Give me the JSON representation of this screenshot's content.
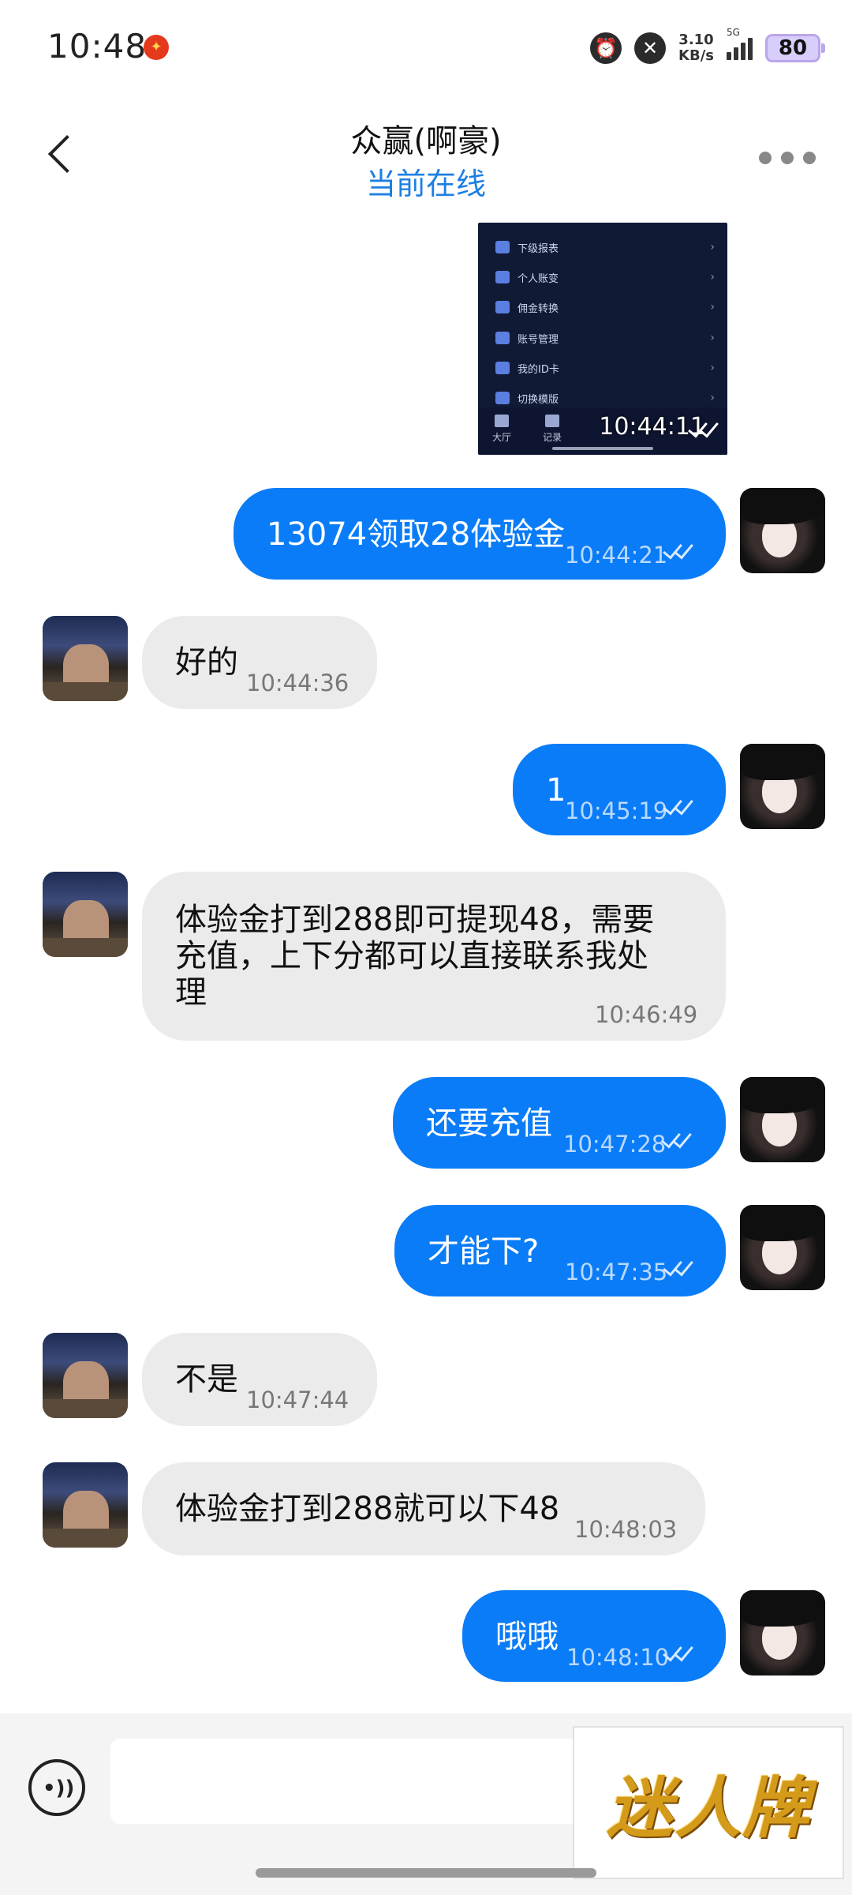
{
  "status_bar": {
    "time": "10:48",
    "net_speed_value": "3.10",
    "net_speed_unit": "KB/s",
    "network_label": "5G",
    "battery": "80"
  },
  "header": {
    "title": "众赢(啊豪)",
    "status": "当前在线"
  },
  "image_message": {
    "menu_items": [
      "下级报表",
      "个人账变",
      "佣金转换",
      "账号管理",
      "我的ID卡",
      "切换模版"
    ],
    "nav_items": [
      "大厅",
      "记录"
    ],
    "time": "10:44:11"
  },
  "messages": [
    {
      "dir": "out",
      "text": "13074领取28体验金",
      "time": "10:44:21"
    },
    {
      "dir": "in",
      "text": "好的",
      "time": "10:44:36"
    },
    {
      "dir": "out",
      "text": "1",
      "time": "10:45:19"
    },
    {
      "dir": "in",
      "lines": [
        "体验金打到288即可提现48，需要",
        "充值，上下分都可以直接联系我处",
        "理"
      ],
      "time": "10:46:49"
    },
    {
      "dir": "out",
      "text": "还要充值",
      "time": "10:47:28"
    },
    {
      "dir": "out",
      "text": "才能下?",
      "time": "10:47:35"
    },
    {
      "dir": "in",
      "text": "不是",
      "time": "10:47:44"
    },
    {
      "dir": "in",
      "text": "体验金打到288就可以下48",
      "time": "10:48:03"
    },
    {
      "dir": "out",
      "text": "哦哦",
      "time": "10:48:10"
    }
  ],
  "input": {
    "value": "",
    "placeholder": ""
  },
  "watermark": "迷人牌"
}
